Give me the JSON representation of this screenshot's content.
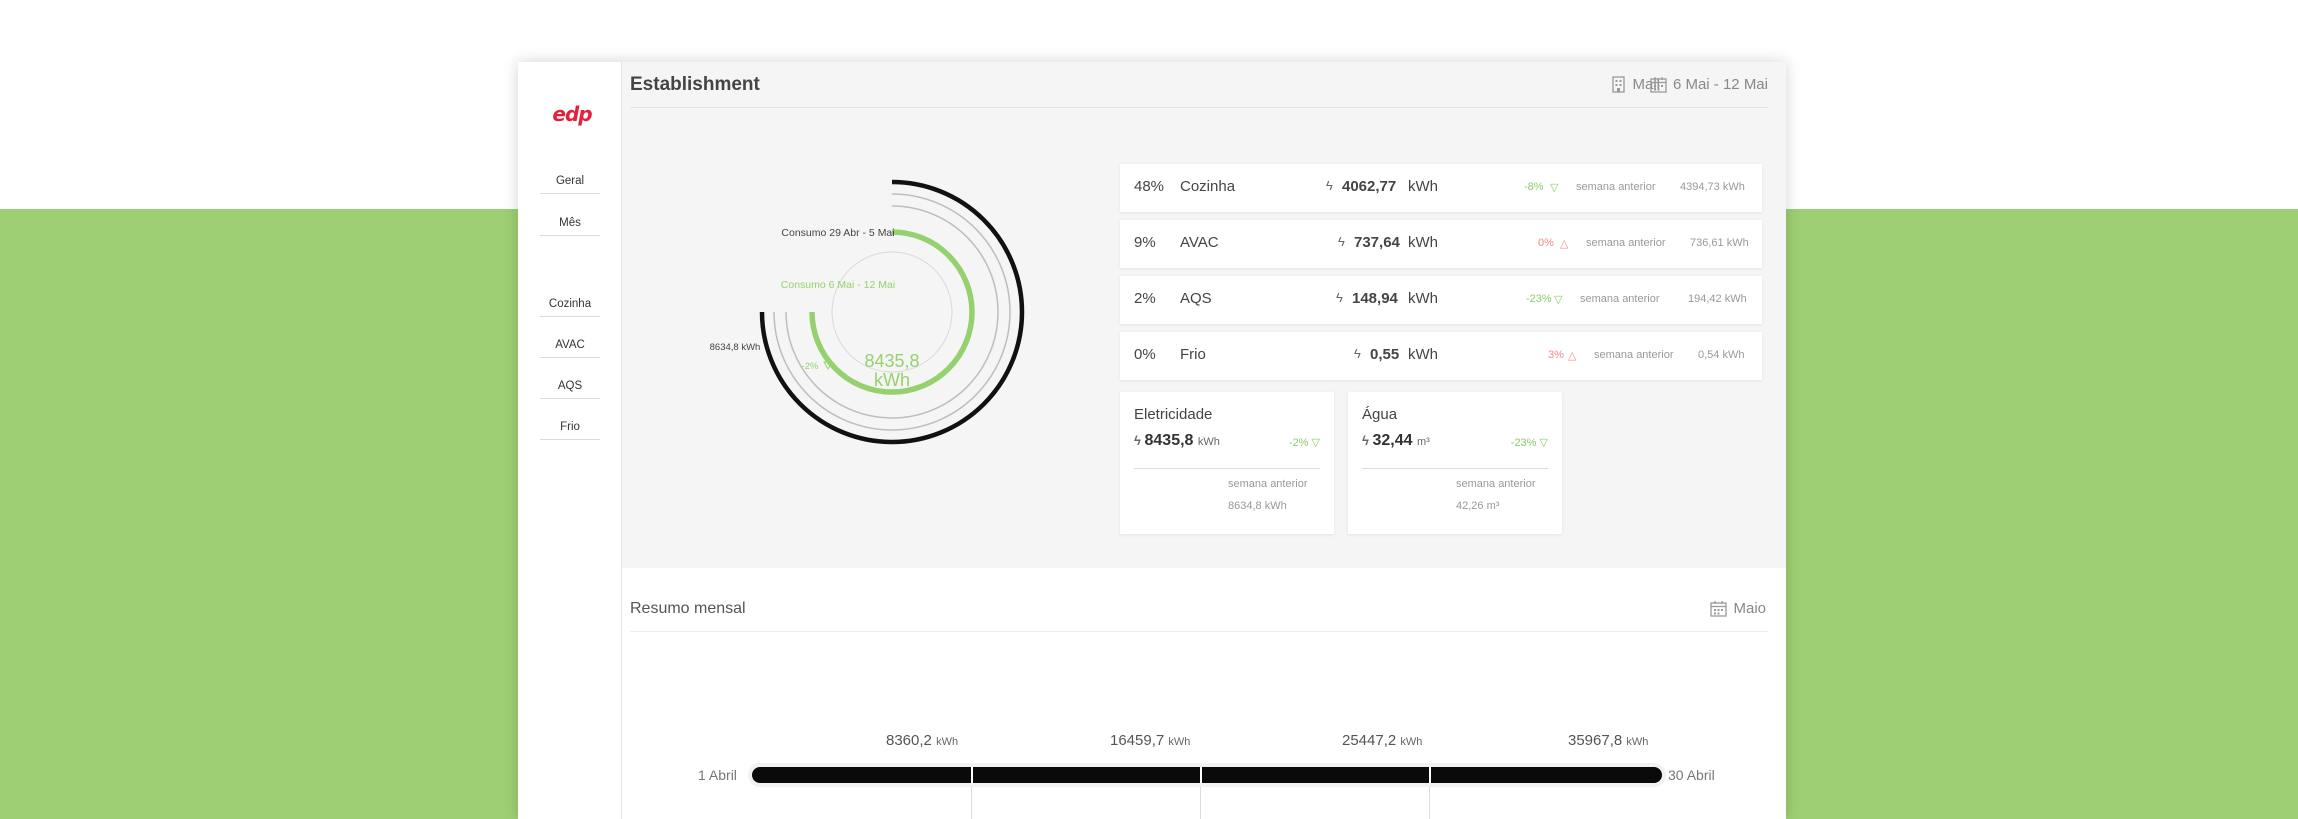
{
  "sidebar": {
    "logo": "edp",
    "items": [
      "Geral",
      "Mês",
      "Cozinha",
      "AVAC",
      "AQS",
      "Frio"
    ]
  },
  "header": {
    "title": "Establishment",
    "location": "Mall",
    "date_range": "6 Mai - 12 Mai"
  },
  "donut": {
    "previous_label": "Consumo 29 Abr - 5 Mai",
    "current_label": "Consumo 6 Mai - 12 Mai",
    "previous_value": "8634,8 kWh",
    "center_value": "8435,8",
    "center_unit": "kWh",
    "delta": "-2%",
    "current_fraction": 0.75,
    "previous_fraction": 0.75,
    "colors": {
      "current": "#95d16e",
      "previous": "#111111",
      "track": "#cfcfcf"
    }
  },
  "categories": [
    {
      "pct": "48%",
      "name": "Cozinha",
      "value": "4062,77",
      "unit": "kWh",
      "delta": "-8%",
      "trend": "down",
      "prev_label": "semana anterior",
      "prev_value": "4394,73 kWh"
    },
    {
      "pct": "9%",
      "name": "AVAC",
      "value": "737,64",
      "unit": "kWh",
      "delta": "0%",
      "trend": "up",
      "prev_label": "semana anterior",
      "prev_value": "736,61 kWh"
    },
    {
      "pct": "2%",
      "name": "AQS",
      "value": "148,94",
      "unit": "kWh",
      "delta": "-23%",
      "trend": "down",
      "prev_label": "semana anterior",
      "prev_value": "194,42 kWh"
    },
    {
      "pct": "0%",
      "name": "Frio",
      "value": "0,55",
      "unit": "kWh",
      "delta": "3%",
      "trend": "up",
      "prev_label": "semana anterior",
      "prev_value": "0,54 kWh"
    }
  ],
  "kpis": [
    {
      "title": "Eletricidade",
      "value": "8435,8",
      "unit": "kWh",
      "delta": "-2%",
      "prev_label": "semana anterior",
      "prev_value": "8634,8 kWh"
    },
    {
      "title": "Água",
      "value": "32,44",
      "unit": "m³",
      "delta": "-23%",
      "prev_label": "semana anterior",
      "prev_value": "42,26 m³"
    }
  ],
  "monthly": {
    "title": "Resumo mensal",
    "month": "Maio",
    "start_label": "1 Abril",
    "end_label": "30 Abril",
    "unit": "kWh",
    "milestones": [
      "8360,2",
      "16459,7",
      "25447,2",
      "35967,8"
    ]
  }
}
